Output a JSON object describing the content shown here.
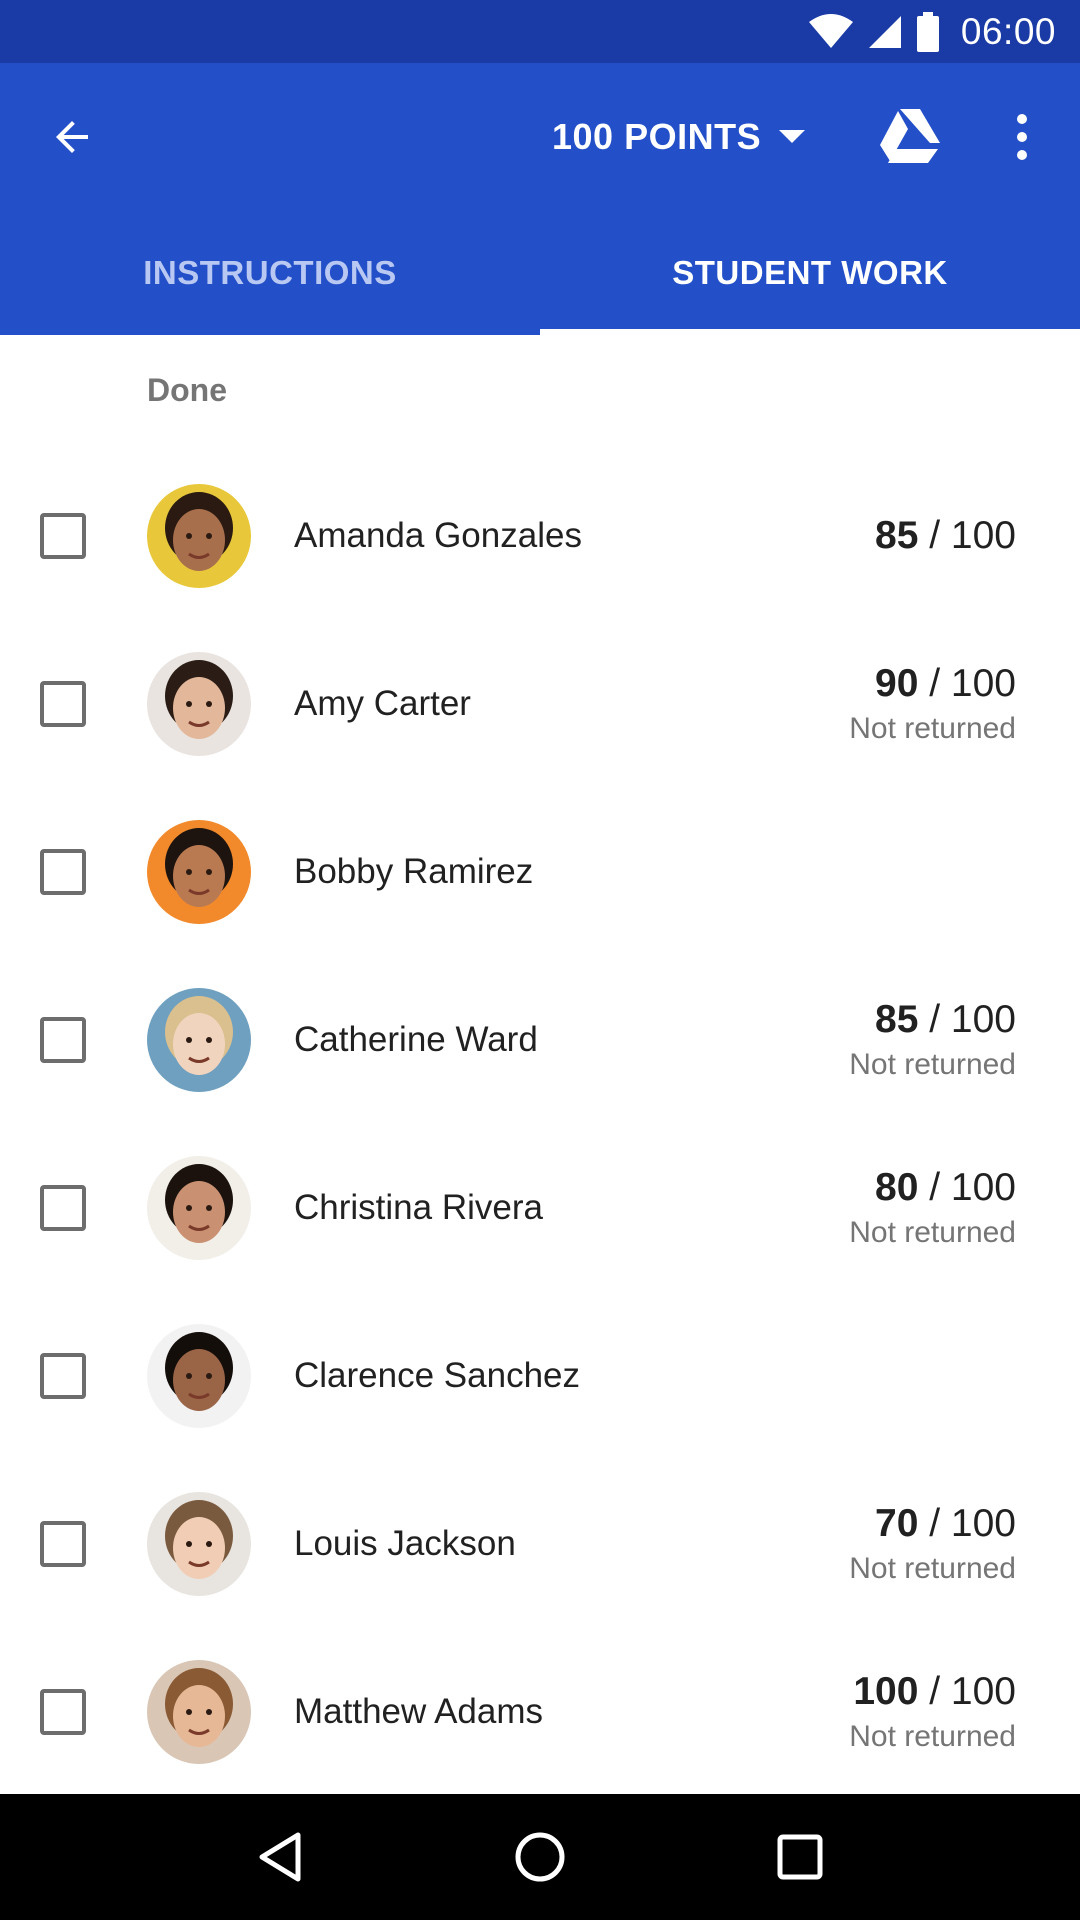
{
  "status_bar": {
    "time": "06:00"
  },
  "toolbar": {
    "points_label": "100 POINTS"
  },
  "tabs": [
    {
      "label": "INSTRUCTIONS",
      "active": false
    },
    {
      "label": "STUDENT WORK",
      "active": true
    }
  ],
  "section": {
    "title": "Done"
  },
  "students": [
    {
      "name": "Amanda Gonzales",
      "score": "85",
      "max": "/ 100",
      "status": "",
      "avatar_bg": "#e8c83a",
      "skin": "#a86f4c",
      "hair": "#2a1a12"
    },
    {
      "name": "Amy Carter",
      "score": "90",
      "max": "/ 100",
      "status": "Not returned",
      "avatar_bg": "#e9e4e0",
      "skin": "#e2b79a",
      "hair": "#2b1d16"
    },
    {
      "name": "Bobby Ramirez",
      "score": "",
      "max": "",
      "status": "",
      "avatar_bg": "#f28a2c",
      "skin": "#b97a52",
      "hair": "#1d1410"
    },
    {
      "name": "Catherine Ward",
      "score": "85",
      "max": "/ 100",
      "status": "Not returned",
      "avatar_bg": "#6fa0c0",
      "skin": "#f1d4be",
      "hair": "#d9c08e"
    },
    {
      "name": "Christina Rivera",
      "score": "80",
      "max": "/ 100",
      "status": "Not returned",
      "avatar_bg": "#f2efe9",
      "skin": "#c99072",
      "hair": "#1b120d"
    },
    {
      "name": "Clarence Sanchez",
      "score": "",
      "max": "",
      "status": "",
      "avatar_bg": "#f2f2f2",
      "skin": "#9a6447",
      "hair": "#140e0b"
    },
    {
      "name": "Louis Jackson",
      "score": "70",
      "max": "/ 100",
      "status": "Not returned",
      "avatar_bg": "#e8e4df",
      "skin": "#f0cdb4",
      "hair": "#7a5a3e"
    },
    {
      "name": "Matthew Adams",
      "score": "100",
      "max": "/ 100",
      "status": "Not returned",
      "avatar_bg": "#d9c6b5",
      "skin": "#e6b896",
      "hair": "#8a5a34"
    }
  ],
  "colors": {
    "status_bar": "#1a3aa6",
    "app_bar": "#2350c8",
    "tab_inactive": "#b8c8f2"
  }
}
